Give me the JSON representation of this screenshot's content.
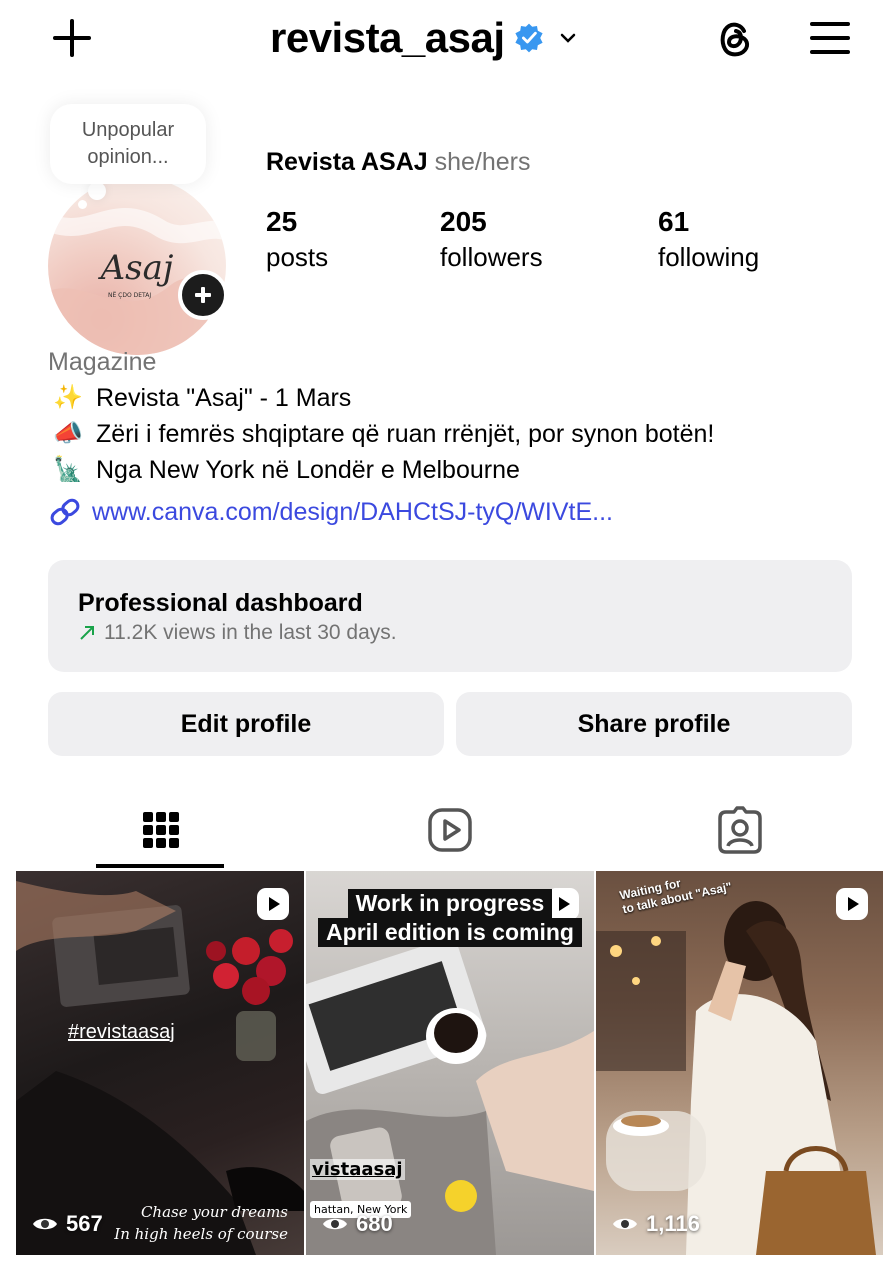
{
  "header": {
    "username": "revista_asaj",
    "icons": [
      "plus-icon",
      "verified-badge-icon",
      "chevron-down-icon",
      "threads-icon",
      "menu-icon"
    ]
  },
  "profile": {
    "note": "Unpopular opinion...",
    "name": "Revista ASAJ",
    "pronouns": "she/hers",
    "stats": [
      {
        "value": "25",
        "label": "posts"
      },
      {
        "value": "205",
        "label": "followers"
      },
      {
        "value": "61",
        "label": "following"
      }
    ]
  },
  "bio": {
    "category": "Magazine",
    "lines": [
      {
        "emoji": "✨",
        "text": "Revista \"Asaj\" - 1 Mars"
      },
      {
        "emoji": "📣",
        "text": "Zëri i femrës shqiptare që ruan rrënjët, por synon botën!"
      },
      {
        "emoji": "🗽",
        "text": "Nga New York në Londër e Melbourne"
      }
    ],
    "link": "www.canva.com/design/DAHCtSJ-tyQ/WIVtE..."
  },
  "dashboard": {
    "title": "Professional dashboard",
    "subtitle": "11.2K views in the last 30 days."
  },
  "buttons": {
    "edit": "Edit profile",
    "share": "Share profile"
  },
  "tabs": [
    "grid-icon",
    "reels-icon",
    "tagged-icon"
  ],
  "posts": [
    {
      "views": "567",
      "hashtag": "#revistaasaj",
      "script_line1": "Chase your dreams",
      "script_line2": "In high heels of course"
    },
    {
      "views": "680",
      "title_line1": "Work in progress",
      "title_line2": "April edition is coming",
      "tag1": "vistaasaj",
      "tag2": "hattan, New York"
    },
    {
      "views": "1,116",
      "caption_line1": "Waiting for",
      "caption_line2": "to talk about \"Asaj\""
    }
  ],
  "colors": {
    "verified": "#3897f0",
    "link": "#3b49df",
    "secondary_text": "#737373",
    "button_bg": "#efeff1",
    "trend": "#1aa34a"
  }
}
